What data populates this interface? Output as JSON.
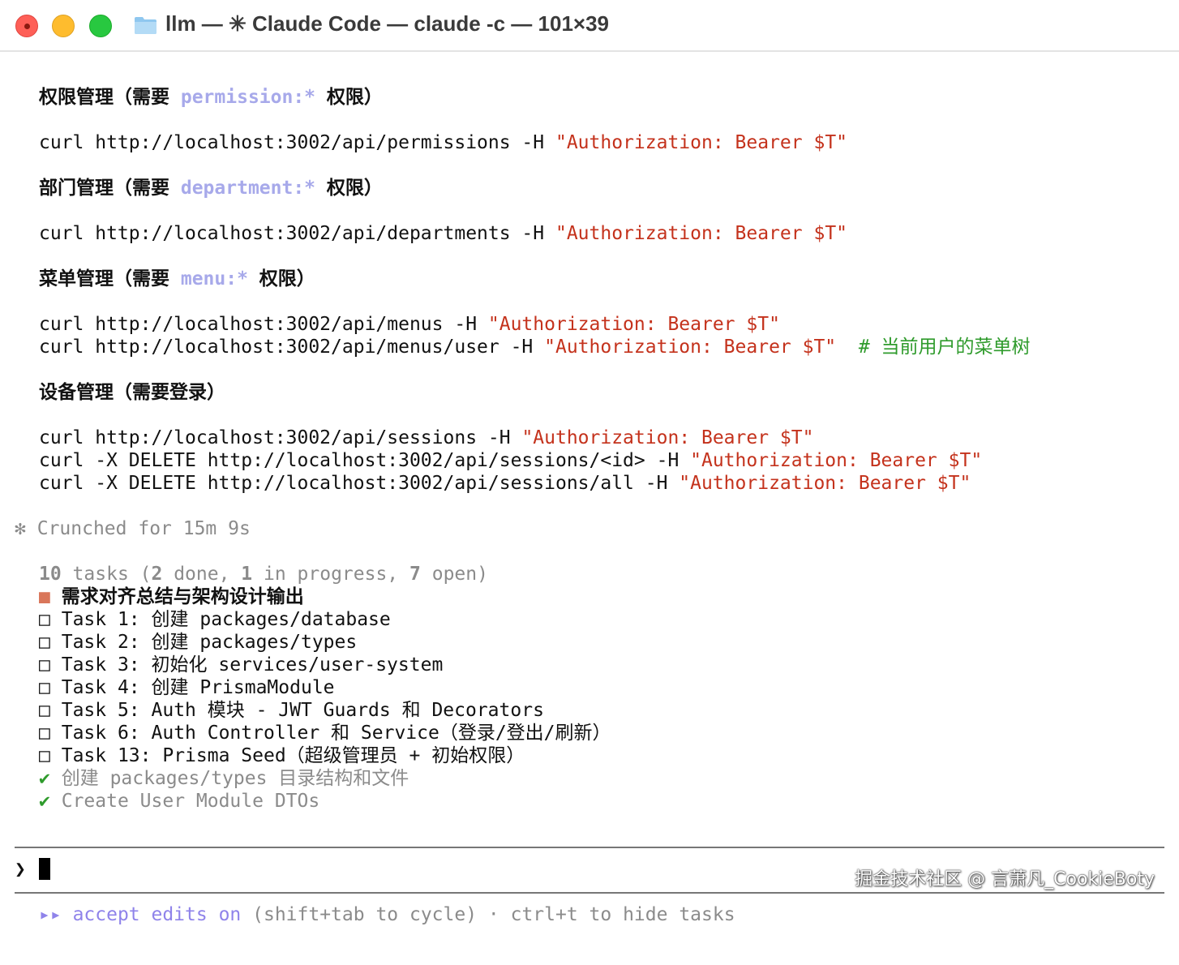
{
  "window": {
    "title": "llm — ✳ Claude Code — claude -c — 101×39"
  },
  "output": {
    "perm_heading": {
      "prefix": "权限管理（需要 ",
      "scope": "permission:*",
      "suffix": " 权限）"
    },
    "perm_cmd": {
      "cmd": "curl http://localhost:3002/api/permissions -H ",
      "header": "\"Authorization: Bearer $T\""
    },
    "dept_heading": {
      "prefix": "部门管理（需要 ",
      "scope": "department:*",
      "suffix": " 权限）"
    },
    "dept_cmd": {
      "cmd": "curl http://localhost:3002/api/departments -H ",
      "header": "\"Authorization: Bearer $T\""
    },
    "menu_heading": {
      "prefix": "菜单管理（需要 ",
      "scope": "menu:*",
      "suffix": " 权限）"
    },
    "menu_cmd_1": {
      "cmd": "curl http://localhost:3002/api/menus -H ",
      "header": "\"Authorization: Bearer $T\""
    },
    "menu_cmd_2": {
      "cmd": "curl http://localhost:3002/api/menus/user -H ",
      "header": "\"Authorization: Bearer $T\"",
      "comment": "# 当前用户的菜单树"
    },
    "device_heading": "设备管理（需要登录）",
    "session_cmd_1": {
      "cmd": "curl http://localhost:3002/api/sessions -H ",
      "header": "\"Authorization: Bearer $T\""
    },
    "session_cmd_2": {
      "cmd": "curl -X DELETE http://localhost:3002/api/sessions/<id> -H ",
      "header": "\"Authorization: Bearer $T\""
    },
    "session_cmd_3": {
      "cmd": "curl -X DELETE http://localhost:3002/api/sessions/all -H ",
      "header": "\"Authorization: Bearer $T\""
    }
  },
  "status": {
    "icon": "✻",
    "text": "Crunched for 15m 9s"
  },
  "tasks": {
    "summary": {
      "total": "10",
      "label_tasks": " tasks (",
      "done": "2",
      "label_done": " done, ",
      "in_progress": "1",
      "label_in_progress": " in progress, ",
      "open": "7",
      "label_open": " open)"
    },
    "items": [
      {
        "state": "in_progress",
        "marker": "■",
        "text": "需求对齐总结与架构设计输出"
      },
      {
        "state": "open",
        "marker": "□",
        "text": "Task 1: 创建 packages/database"
      },
      {
        "state": "open",
        "marker": "□",
        "text": "Task 2: 创建 packages/types"
      },
      {
        "state": "open",
        "marker": "□",
        "text": "Task 3: 初始化 services/user-system"
      },
      {
        "state": "open",
        "marker": "□",
        "text": "Task 4: 创建 PrismaModule"
      },
      {
        "state": "open",
        "marker": "□",
        "text": "Task 5: Auth 模块 - JWT Guards 和 Decorators"
      },
      {
        "state": "open",
        "marker": "□",
        "text": "Task 6: Auth Controller 和 Service（登录/登出/刷新）"
      },
      {
        "state": "open",
        "marker": "□",
        "text": "Task 13: Prisma Seed（超级管理员 + 初始权限）"
      },
      {
        "state": "done",
        "marker": "✔",
        "text": "创建 packages/types 目录结构和文件"
      },
      {
        "state": "done",
        "marker": "✔",
        "text": "Create User Module DTOs"
      }
    ]
  },
  "prompt": {
    "symbol": "❯",
    "value": ""
  },
  "footer": {
    "arrows": "▸▸",
    "mode": "accept edits on",
    "hint": " (shift+tab to cycle) · ctrl+t to hide tasks"
  },
  "watermark": "掘金技术社区 @ 言萧凡_CookieBoty",
  "colors": {
    "string": "#c4321c",
    "permission_scope": "#a7a9ea",
    "comment": "#2f9b2c",
    "dim": "#8b8b8b",
    "accent": "#8f83ea",
    "in_progress_marker": "#d9765a"
  }
}
